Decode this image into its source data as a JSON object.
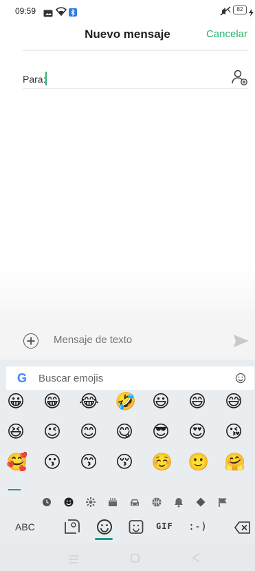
{
  "status_bar": {
    "time": "09:59",
    "battery": "82"
  },
  "header": {
    "title": "Nuevo mensaje",
    "cancel_label": "Cancelar"
  },
  "recipient": {
    "label": "Para:"
  },
  "compose": {
    "placeholder": "Mensaje de texto"
  },
  "keyboard": {
    "search_placeholder": "Buscar emojis",
    "google_logo": "G",
    "emoji_rows": [
      [
        "😀",
        "😁",
        "😂",
        "🤣",
        "😃",
        "😄",
        "😅"
      ],
      [
        "😆",
        "😉",
        "😊",
        "😋",
        "😎",
        "😍",
        "😘"
      ],
      [
        "🥰",
        "😗",
        "😙",
        "😚",
        "☺️",
        "🙂",
        "🤗"
      ]
    ],
    "category_icons": [
      "recent-icon",
      "smileys-icon",
      "nature-icon",
      "food-icon",
      "travel-icon",
      "activities-icon",
      "objects-icon",
      "symbols-icon",
      "flags-icon"
    ],
    "bottom_row": {
      "abc_label": "ABC",
      "emoticon_label": ":-)",
      "gif_label": "GIF"
    }
  },
  "colors": {
    "accent": "#27b36a",
    "keyboard_accent": "#1e9a8c",
    "keyboard_bg": "#e9edf0"
  }
}
